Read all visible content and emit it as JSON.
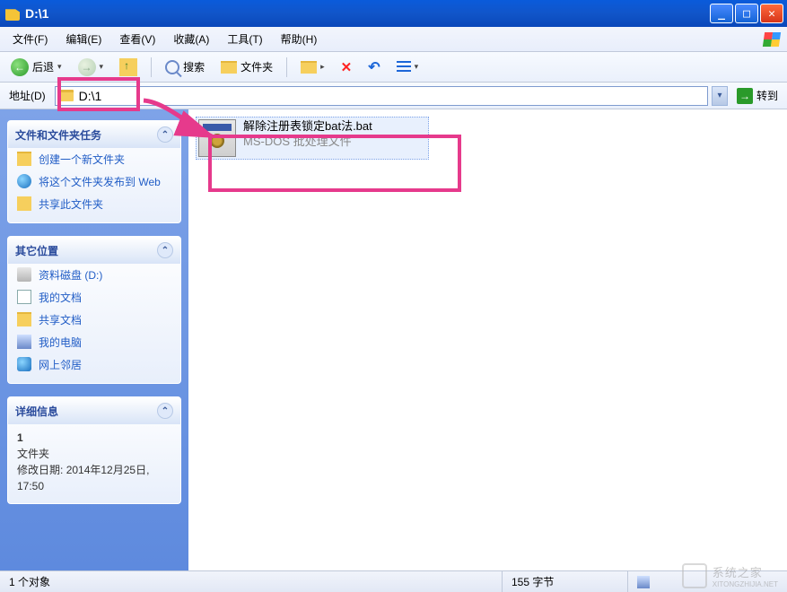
{
  "window": {
    "title": "D:\\1"
  },
  "menu": {
    "file": "文件(F)",
    "edit": "编辑(E)",
    "view": "查看(V)",
    "favorites": "收藏(A)",
    "tools": "工具(T)",
    "help": "帮助(H)"
  },
  "toolbar": {
    "back": "后退",
    "search": "搜索",
    "folders": "文件夹"
  },
  "address": {
    "label": "地址(D)",
    "value": "D:\\1",
    "go": "转到"
  },
  "sidebar": {
    "panel1": {
      "title": "文件和文件夹任务",
      "items": [
        "创建一个新文件夹",
        "将这个文件夹发布到 Web",
        "共享此文件夹"
      ]
    },
    "panel2": {
      "title": "其它位置",
      "items": [
        "资料磁盘 (D:)",
        "我的文档",
        "共享文档",
        "我的电脑",
        "网上邻居"
      ]
    },
    "panel3": {
      "title": "详细信息",
      "name": "1",
      "type": "文件夹",
      "modified_label": "修改日期:",
      "modified_value": "2014年12月25日, 17:50"
    }
  },
  "content": {
    "file": {
      "name": "解除注册表锁定bat法.bat",
      "type": "MS-DOS 批处理文件"
    }
  },
  "status": {
    "left": "1 个对象",
    "mid": "155 字节"
  },
  "watermark": {
    "text_cn": "系统之家",
    "text_en": "XITONGZHIJIA.NET"
  }
}
